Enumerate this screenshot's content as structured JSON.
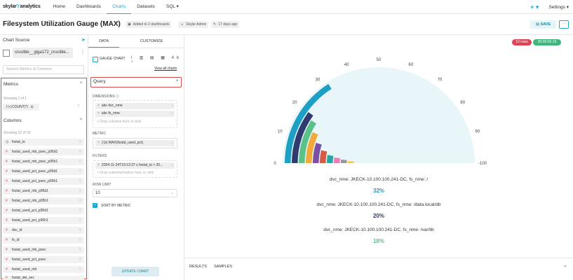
{
  "nav": {
    "logo_main": "skylar",
    "logo_accent": "Ⲩ",
    "logo_tail": "analytics",
    "items": [
      "Home",
      "Dashboards",
      "Charts",
      "Datasets",
      "SQL ▾"
    ],
    "plus": "+ ▾",
    "settings": "Settings ▾"
  },
  "title": {
    "name": "Filesystem Utilization Gauge (MAX)",
    "added": "Added to 2 dashboards",
    "owner": "Skylar Admin",
    "modified": "17 days ago",
    "save": "SAVE",
    "more": "···"
  },
  "left": {
    "chart_source": "Chart Source",
    "dataset": "crucible__giga172_crucible...",
    "search_placeholder": "Search Metrics & Columns",
    "metrics_title": "Metrics",
    "metrics_showing": "Showing 1 of 1",
    "metric_item": "COUNT(*)",
    "columns_title": "Columns",
    "columns_showing": "Showing 22 of 22",
    "columns": [
      "fsstat_ts",
      "fsstat_used_mb_psec_p95d1",
      "fsstat_used_mb_psec_p95h1",
      "fsstat_used_pct_psec_p95d1",
      "fsstat_used_pct_psec_p95h1",
      "fsstat_used_mb_p95d1",
      "fsstat_used_mb_p95h1",
      "fsstat_used_pct_p95d1",
      "fsstat_used_pct_p95h1",
      "dvc_id",
      "fs_id",
      "fsstat_used_mb_psec",
      "fsstat_used_pct_psec",
      "fsstat_used_mb",
      "fsstat_del_sec"
    ]
  },
  "mid": {
    "tab_data": "DATA",
    "tab_customize": "CUSTOMIZE",
    "viz_name": "GAUGE CHART",
    "view_all": "View all charts",
    "query": "Query",
    "dimensions_label": "DIMENSIONS ⓘ",
    "dim1": "abc  dvc_nme",
    "dim2": "abc  fs_nme",
    "drop_columns": "+ Drop columns here or click",
    "metric_label": "METRIC",
    "metric_value": "ƒ(x)  MAX(fsstat_used_pct)",
    "filters_label": "FILTERS",
    "filter1": "2024-11-24T19:13:37 ≤ fsstat_ts < 20...",
    "drop_filters": "+ Drop columns/metrics here or click",
    "rowlimit_label": "ROW LIMIT",
    "rowlimit_value": "10",
    "sort_label": "SORT BY METRIC",
    "update": "UPDATE CHART"
  },
  "right": {
    "rows_badge": "10 rows",
    "time_badge": "00:00:00.19",
    "colors": {
      "rows": "#e04355",
      "time": "#3fb77a"
    },
    "results_tab": "RESULTS",
    "samples_tab": "SAMPLES"
  },
  "chart_data": {
    "type": "gauge",
    "min": 0,
    "max": 100,
    "tick_labels": [
      "0",
      "10",
      "20",
      "30",
      "40",
      "50",
      "60",
      "70",
      "80",
      "90",
      "-100"
    ],
    "series": [
      {
        "name": "dvc_nme: JKECK-10.100.100.241-DC, fs_nme: /",
        "value": 32,
        "label": "32%",
        "color": "#1ea0c6"
      },
      {
        "name": "dvc_nme: JKECK-10.100.100.241-DC, fs_nme: /data.local/db",
        "value": 20,
        "label": "20%",
        "color": "#2f3a6e"
      },
      {
        "name": "dvc_nme: JKECK-10.100.100.241-DC, fs_nme: /var/lib",
        "value": 18,
        "label": "18%",
        "color": "#5ac189"
      },
      {
        "value": 14,
        "color": "#f2a93b"
      },
      {
        "value": 10,
        "color": "#7b4fa2"
      },
      {
        "value": 7,
        "color": "#d85a45"
      },
      {
        "value": 5,
        "color": "#2aa3a3"
      },
      {
        "value": 4,
        "color": "#ea7fb4"
      },
      {
        "value": 3,
        "color": "#999999"
      },
      {
        "value": 2,
        "color": "#f2c84b"
      }
    ]
  }
}
